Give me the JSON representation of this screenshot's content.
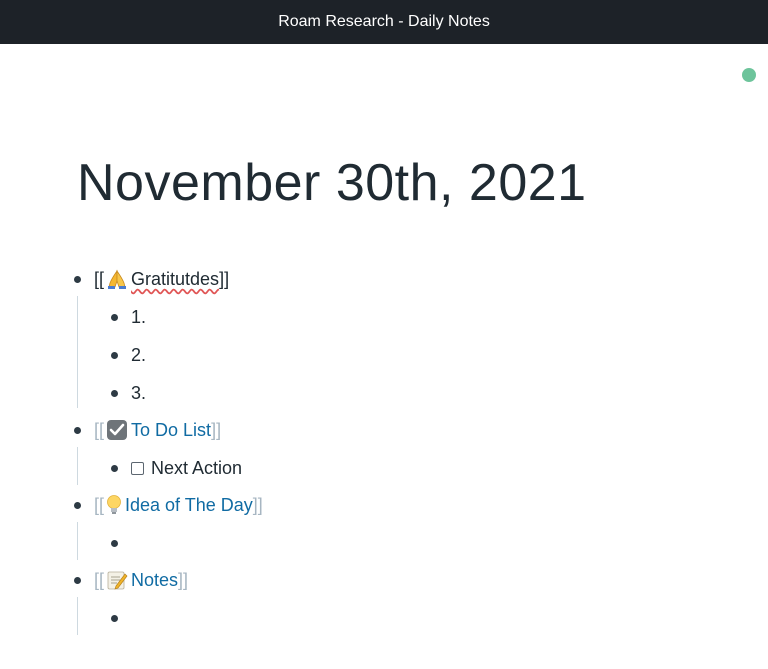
{
  "window": {
    "title": "Roam Research - Daily Notes"
  },
  "status": {
    "sync_color": "#6dc49b"
  },
  "page": {
    "title": "November 30th, 2021"
  },
  "blocks": {
    "gratitudes": {
      "open": "[[",
      "icon": "folded-hands-icon",
      "label": "Gratitutdes",
      "close": "]]",
      "children": [
        "1.",
        "2.",
        "3."
      ]
    },
    "todo": {
      "open": "[[",
      "icon": "check-mark-icon",
      "label": "To Do List",
      "close": "]]",
      "children": [
        "Next Action"
      ]
    },
    "idea": {
      "open": "[[",
      "icon": "light-bulb-icon",
      "label": "Idea of The Day",
      "close": "]]",
      "children": [
        ""
      ]
    },
    "notes": {
      "open": "[[",
      "icon": "memo-icon",
      "label": "Notes",
      "close": "]]",
      "children": [
        ""
      ]
    }
  },
  "colors": {
    "link": "#106ba3",
    "bracket_muted": "#a7b6c2",
    "titlebar_bg": "#1d2228"
  }
}
